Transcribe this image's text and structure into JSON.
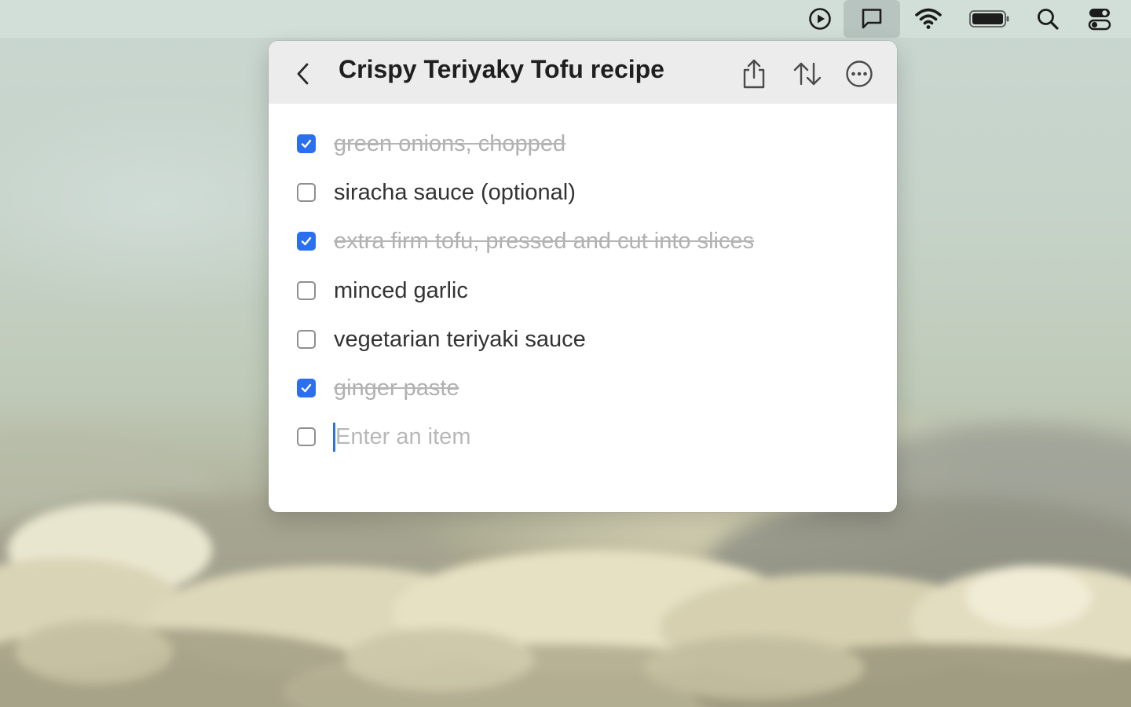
{
  "menubar": {
    "items": [
      {
        "name": "play-icon"
      },
      {
        "name": "notes-icon",
        "active": true
      },
      {
        "name": "wifi-icon"
      },
      {
        "name": "battery-icon"
      },
      {
        "name": "search-icon"
      },
      {
        "name": "control-center-icon"
      }
    ]
  },
  "panel": {
    "title": "Crispy Teriyaky Tofu recipe",
    "header_icons": {
      "back": "chevron-left-icon",
      "share": "share-icon",
      "sort": "sort-icon",
      "more": "more-icon"
    },
    "items": [
      {
        "text": "green onions, chopped",
        "checked": true
      },
      {
        "text": "siracha sauce (optional)",
        "checked": false
      },
      {
        "text": "extra firm tofu, pressed and cut into slices",
        "checked": true
      },
      {
        "text": "minced garlic",
        "checked": false
      },
      {
        "text": "vegetarian teriyaki sauce",
        "checked": false
      },
      {
        "text": "ginger paste",
        "checked": true
      }
    ],
    "new_item": {
      "placeholder": "Enter an item",
      "value": ""
    }
  },
  "colors": {
    "accent": "#2a6ff0",
    "header_bg": "#ececec",
    "done_text": "#b0b0b0",
    "text": "#333333"
  }
}
